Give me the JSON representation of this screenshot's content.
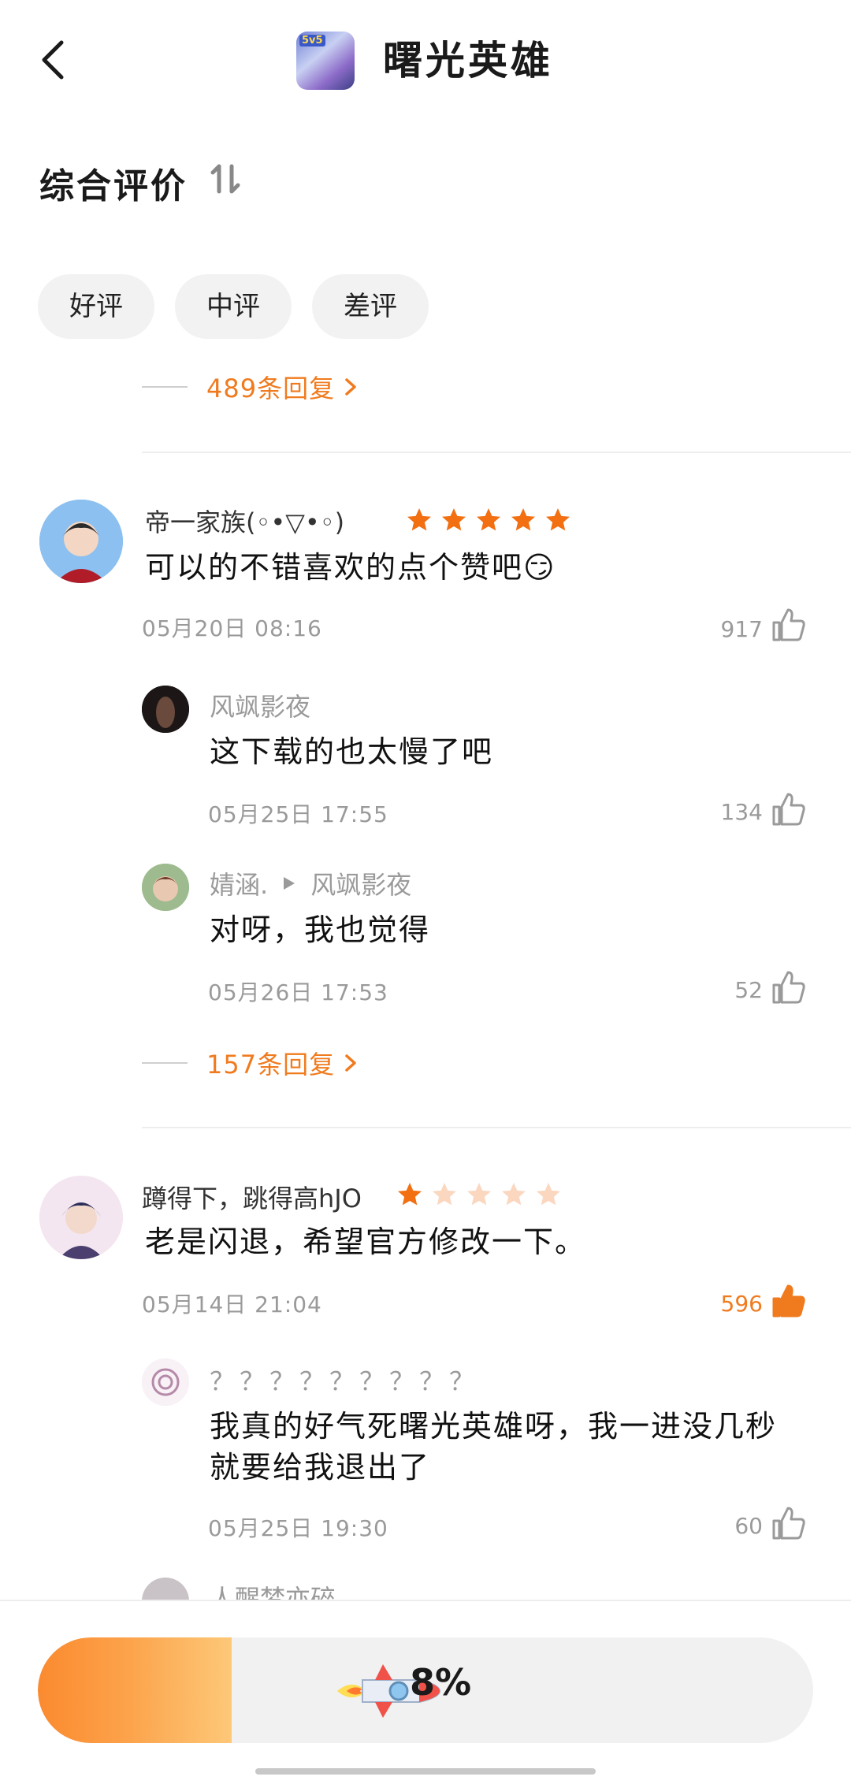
{
  "header": {
    "title": "曙光英雄",
    "app_icon_badge": "5v5"
  },
  "section": {
    "title": "综合评价"
  },
  "filters": [
    {
      "label": "好评"
    },
    {
      "label": "中评"
    },
    {
      "label": "差评"
    }
  ],
  "top_replies_link": "489条回复",
  "reviews": [
    {
      "author": "帝一家族(◦•▽•◦)",
      "rating": 5,
      "text": "可以的不错喜欢的点个赞吧😏",
      "time": "05月20日 08:16",
      "likes": "917",
      "liked": false,
      "replies": [
        {
          "author": "风飒影夜",
          "reply_to": "",
          "text": "这下载的也太慢了吧",
          "time": "05月25日 17:55",
          "likes": "134"
        },
        {
          "author": "婧涵.",
          "reply_to": "风飒影夜",
          "text": "对呀，我也觉得",
          "time": "05月26日 17:53",
          "likes": "52"
        }
      ],
      "more_replies": "157条回复"
    },
    {
      "author": "蹲得下，跳得高hJO",
      "rating": 1,
      "text": "老是闪退，希望官方修改一下。",
      "time": "05月14日 21:04",
      "likes": "596",
      "liked": true,
      "replies": [
        {
          "author": "？？？？？？？？？",
          "reply_to": "",
          "text_line1": "我真的好气死曙光英雄呀，我一进没几秒",
          "text_line2": "就要给我退出了",
          "time": "05月25日 19:30",
          "likes": "60"
        },
        {
          "author": "人醒梦亦碎"
        }
      ]
    }
  ],
  "download": {
    "progress_text": "8%",
    "progress": 0.25
  },
  "colors": {
    "accent": "#f07b1f",
    "star_on": "#f26f12",
    "star_off": "#fbd7c0"
  }
}
